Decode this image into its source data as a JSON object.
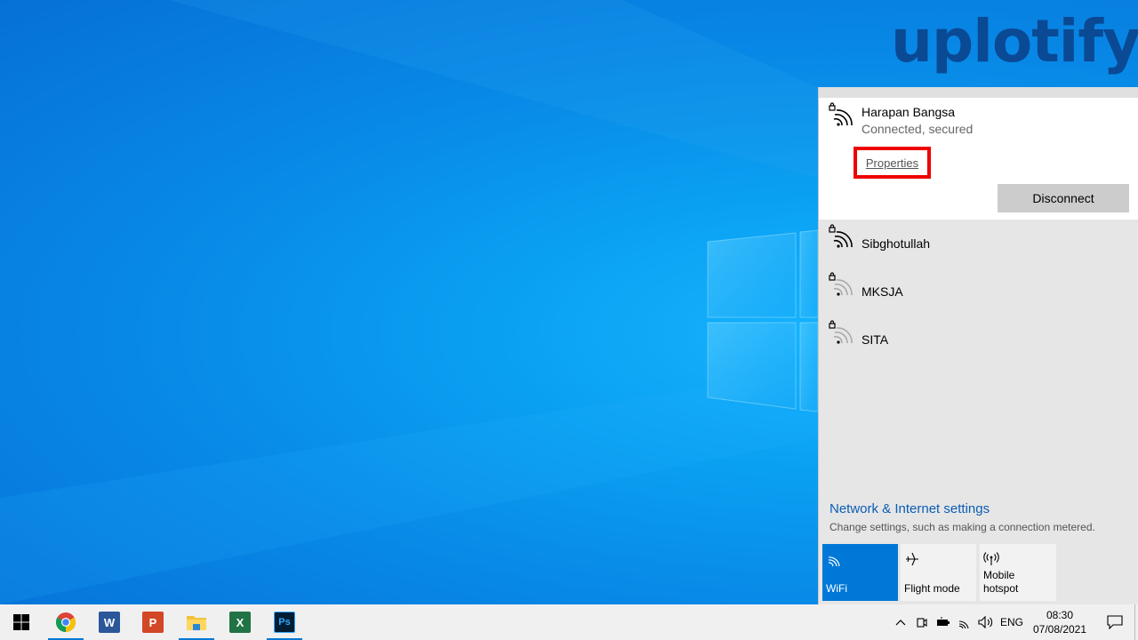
{
  "watermark": "uplotify",
  "flyout": {
    "connected": {
      "name": "Harapan Bangsa",
      "status": "Connected, secured",
      "properties_label": "Properties",
      "disconnect_label": "Disconnect"
    },
    "networks": [
      {
        "name": "Sibghotullah",
        "icon": "wifi-secured-strong-icon"
      },
      {
        "name": "MKSJA",
        "icon": "wifi-secured-weak-icon"
      },
      {
        "name": "SITA",
        "icon": "wifi-secured-weak-icon"
      }
    ],
    "settings_link": "Network & Internet settings",
    "settings_desc": "Change settings, such as making a connection metered.",
    "tiles": [
      {
        "label": "WiFi",
        "icon": "wifi-icon",
        "active": true
      },
      {
        "label": "Flight mode",
        "icon": "airplane-icon",
        "active": false
      },
      {
        "label": "Mobile hotspot",
        "icon": "hotspot-icon",
        "active": false
      }
    ]
  },
  "taskbar": {
    "apps": [
      {
        "name": "Chrome",
        "icon": "chrome-icon"
      },
      {
        "name": "Word",
        "icon": "word-icon",
        "glyph": "W"
      },
      {
        "name": "PowerPoint",
        "icon": "powerpoint-icon",
        "glyph": "P"
      },
      {
        "name": "File Explorer",
        "icon": "folder-icon"
      },
      {
        "name": "Excel",
        "icon": "excel-icon",
        "glyph": "X"
      },
      {
        "name": "Photoshop",
        "icon": "photoshop-icon",
        "glyph": "Ps"
      }
    ],
    "language": "ENG",
    "time": "08:30",
    "date": "07/08/2021"
  },
  "colors": {
    "accent": "#0078d7",
    "highlight": "#ee0000",
    "link": "#0a5db5"
  }
}
